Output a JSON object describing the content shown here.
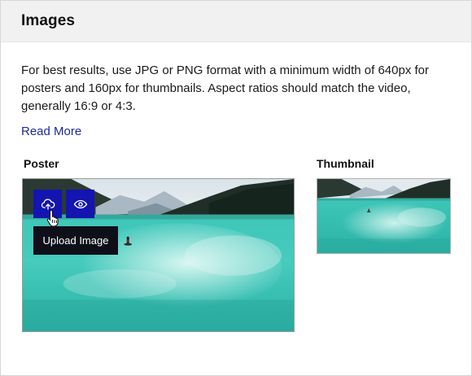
{
  "panel": {
    "title": "Images",
    "description": "For best results, use JPG or PNG format with a minimum width of 640px for posters and 160px for thumbnails. Aspect ratios should match the video, generally 16:9 or 4:3.",
    "read_more_label": "Read More"
  },
  "poster": {
    "label": "Poster",
    "upload_icon": "upload-cloud-icon",
    "preview_icon": "eye-icon",
    "tooltip": "Upload Image"
  },
  "thumbnail": {
    "label": "Thumbnail"
  },
  "colors": {
    "accent": "#1414b0",
    "link": "#1b2a9a",
    "header_bg": "#f1f1f1",
    "tooltip_bg": "#0f0f1a",
    "water": "#39c2b4"
  }
}
